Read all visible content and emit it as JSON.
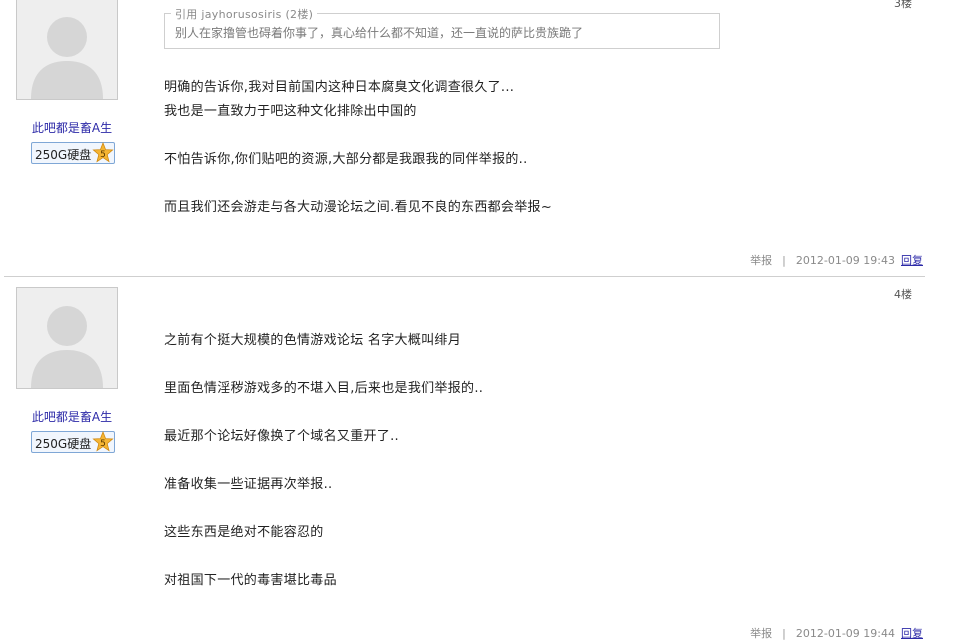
{
  "posts": [
    {
      "floor": "3楼",
      "username": "此吧都是畜A生",
      "badge": {
        "label": "250G硬盘",
        "level": "5"
      },
      "quote": {
        "header": "引用 jayhorusosiris (2楼)",
        "text": "别人在家撸管也碍着你事了，真心给什么都不知道，还一直说的萨比贵族跪了"
      },
      "lines": [
        "明确的告诉你,我对目前国内这种日本腐臭文化调查很久了...",
        "我也是一直致力于吧这种文化排除出中国的",
        "不怕告诉你,你们贴吧的资源,大部分都是我跟我的同伴举报的..",
        "而且我们还会游走与各大动漫论坛之间.看见不良的东西都会举报~"
      ],
      "report": "举报",
      "time": "2012-01-09 19:43",
      "reply": "回复"
    },
    {
      "floor": "4楼",
      "username": "此吧都是畜A生",
      "badge": {
        "label": "250G硬盘",
        "level": "5"
      },
      "lines": [
        "之前有个挺大规模的色情游戏论坛 名字大概叫绯月",
        "里面色情淫秽游戏多的不堪入目,后来也是我们举报的..",
        "最近那个论坛好像换了个域名又重开了..",
        "准备收集一些证据再次举报..",
        "这些东西是绝对不能容忍的",
        "对祖国下一代的毒害堪比毒品"
      ],
      "report": "举报",
      "time": "2012-01-09 19:44",
      "reply": "回复"
    }
  ]
}
